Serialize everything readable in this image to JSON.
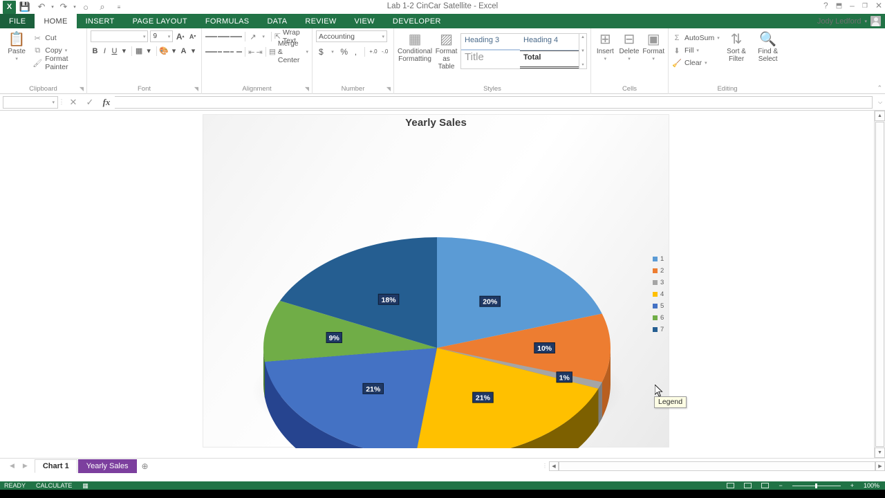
{
  "window": {
    "title": "Lab 1-2 CinCar Satellite - Excel",
    "user": "Jody Ledford",
    "help": "?",
    "ribbon_options": "⬒",
    "minimize": "–",
    "restore": "❐",
    "close": "✕"
  },
  "qat": {
    "logo": "X",
    "save": "💾",
    "undo": "↶",
    "redo": "↷",
    "touch": "○",
    "print_preview": "⌕",
    "customize": "≡"
  },
  "ribbon_tabs": [
    {
      "label": "FILE",
      "active": false
    },
    {
      "label": "HOME",
      "active": true
    },
    {
      "label": "INSERT",
      "active": false
    },
    {
      "label": "PAGE LAYOUT",
      "active": false
    },
    {
      "label": "FORMULAS",
      "active": false
    },
    {
      "label": "DATA",
      "active": false
    },
    {
      "label": "REVIEW",
      "active": false
    },
    {
      "label": "VIEW",
      "active": false
    },
    {
      "label": "DEVELOPER",
      "active": false
    }
  ],
  "clipboard": {
    "group_label": "Clipboard",
    "paste": "Paste",
    "cut": "Cut",
    "copy": "Copy",
    "format_painter": "Format Painter"
  },
  "font": {
    "group_label": "Font",
    "name": "",
    "size": "9",
    "grow": "A",
    "shrink": "A",
    "bold": "B",
    "italic": "I",
    "underline": "U",
    "borders": "▦",
    "fill_color": "A",
    "font_color": "A"
  },
  "alignment": {
    "group_label": "Alignment",
    "orientation": "↗",
    "wrap_text": "Wrap Text",
    "merge_center": "Merge & Center",
    "decrease_indent": "⇤",
    "increase_indent": "⇥"
  },
  "number": {
    "group_label": "Number",
    "format": "Accounting",
    "currency": "$",
    "percent": "%",
    "comma": ",",
    "increase_decimal": "+.0",
    "decrease_decimal": "-.0"
  },
  "styles": {
    "group_label": "Styles",
    "conditional_formatting": "Conditional Formatting",
    "format_as_table": "Format as Table",
    "gallery": [
      "Heading 3",
      "Heading 4",
      "Title",
      "Total"
    ]
  },
  "cells": {
    "group_label": "Cells",
    "insert": "Insert",
    "delete": "Delete",
    "format": "Format"
  },
  "editing": {
    "group_label": "Editing",
    "autosum": "AutoSum",
    "fill": "Fill",
    "clear": "Clear",
    "sort_filter": "Sort & Filter",
    "find_select": "Find & Select"
  },
  "formula_bar": {
    "name_box": "",
    "cancel": "✕",
    "enter": "✓",
    "insert_function": "fx",
    "value": "",
    "expand": "⌵"
  },
  "chart_data": {
    "type": "pie",
    "title": "Yearly Sales",
    "three_d": true,
    "legend_position": "right",
    "categories": [
      "1",
      "2",
      "3",
      "4",
      "5",
      "6",
      "7"
    ],
    "labels": [
      "20%",
      "10%",
      "1%",
      "21%",
      "21%",
      "9%",
      "18%"
    ],
    "values": [
      20,
      10,
      1,
      21,
      21,
      9,
      18
    ],
    "colors": [
      "#5b9bd5",
      "#ed7d31",
      "#a5a5a5",
      "#ffc000",
      "#4472c4",
      "#70ad47",
      "#255e91"
    ],
    "side_colors": [
      "#3c7ab2",
      "#b85f20",
      "#7d7d7d",
      "#7d6000",
      "#26448f",
      "#4d7a31",
      "#1a4266"
    ],
    "data_label_bg": "#1f3864",
    "data_label_color": "#ffffff"
  },
  "chart_legend": [
    {
      "label": "1",
      "color": "#5b9bd5"
    },
    {
      "label": "2",
      "color": "#ed7d31"
    },
    {
      "label": "3",
      "color": "#a5a5a5"
    },
    {
      "label": "4",
      "color": "#ffc000"
    },
    {
      "label": "5",
      "color": "#4472c4"
    },
    {
      "label": "6",
      "color": "#70ad47"
    },
    {
      "label": "7",
      "color": "#255e91"
    }
  ],
  "tooltip": {
    "text": "Legend"
  },
  "sheet_tabs": {
    "first": "◀",
    "prev": "◀",
    "next": "▶",
    "last": "▶",
    "tabs": [
      {
        "label": "Chart 1",
        "active": true
      },
      {
        "label": "Yearly Sales",
        "active": false
      }
    ],
    "add": "⊕"
  },
  "scrollbars": {
    "up": "▲",
    "down": "▼",
    "left": "◀",
    "right": "▶"
  },
  "status_bar": {
    "ready": "READY",
    "calculate": "CALCULATE",
    "zoom": "100%"
  }
}
